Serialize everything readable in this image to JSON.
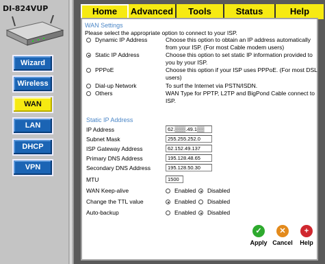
{
  "sidebar": {
    "model": "DI-824VUP",
    "items": [
      {
        "label": "Wizard"
      },
      {
        "label": "Wireless"
      },
      {
        "label": "WAN",
        "active": true
      },
      {
        "label": "LAN"
      },
      {
        "label": "DHCP"
      },
      {
        "label": "VPN"
      }
    ]
  },
  "tabs": [
    {
      "label": "Home",
      "active": true
    },
    {
      "label": "Advanced"
    },
    {
      "label": "Tools"
    },
    {
      "label": "Status"
    },
    {
      "label": "Help"
    }
  ],
  "wan": {
    "section_title": "WAN Settings",
    "intro": "Please select the appropriate option to connect to your ISP.",
    "options": [
      {
        "label": "Dynamic IP Address",
        "desc": "Choose this option to obtain an IP address automatically from your ISP. (For most Cable modem users)",
        "selected": false
      },
      {
        "label": "Static IP Address",
        "desc": "Choose this option to set static IP information provided to you by your ISP.",
        "selected": true
      },
      {
        "label": "PPPoE",
        "desc": "Choose this option if your ISP uses PPPoE. (For most DSL users)",
        "selected": false
      },
      {
        "label": "Dial-up Network",
        "desc": "To surf the Internet via PSTN/ISDN.",
        "selected": false
      },
      {
        "label": "Others",
        "desc": "WAN Type for PPTP, L2TP and BigPond Cable connect to ISP.",
        "selected": false
      }
    ]
  },
  "static": {
    "section_title": "Static IP Address",
    "ip_label": "IP Address",
    "ip_value": "62.▒▒▒.49.1▒▒",
    "mask_label": "Subnet Mask",
    "mask_value": "255.255.252.0",
    "gateway_label": "ISP Gateway Address",
    "gateway_value": "62.152.49.137",
    "dns1_label": "Primary DNS Address",
    "dns1_value": "195.128.48.65",
    "dns2_label": "Secondary DNS Address",
    "dns2_value": "195.128.50.30",
    "mtu_label": "MTU",
    "mtu_value": "1500",
    "keepalive_label": "WAN Keep-alive",
    "ttl_label": "Change the TTL value",
    "backup_label": "Auto-backup",
    "enabled_label": "Enabled",
    "disabled_label": "Disabled"
  },
  "actions": {
    "apply": "Apply",
    "cancel": "Cancel",
    "help": "Help"
  }
}
